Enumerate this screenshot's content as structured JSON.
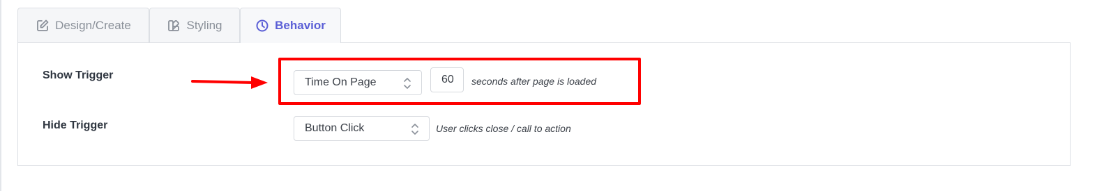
{
  "tabs": [
    {
      "label": "Design/Create",
      "icon": "edit-icon",
      "active": false
    },
    {
      "label": "Styling",
      "icon": "palette-icon",
      "active": false
    },
    {
      "label": "Behavior",
      "icon": "clock-icon",
      "active": true
    }
  ],
  "show_trigger": {
    "label": "Show Trigger",
    "selected": "Time On Page",
    "seconds_value": "60",
    "hint": "seconds after page is loaded"
  },
  "hide_trigger": {
    "label": "Hide Trigger",
    "selected": "Button Click",
    "hint": "User clicks close / call to action"
  },
  "colors": {
    "accent": "#5b5fd6",
    "annotation": "#ff0000",
    "border": "#dcdfe4"
  }
}
